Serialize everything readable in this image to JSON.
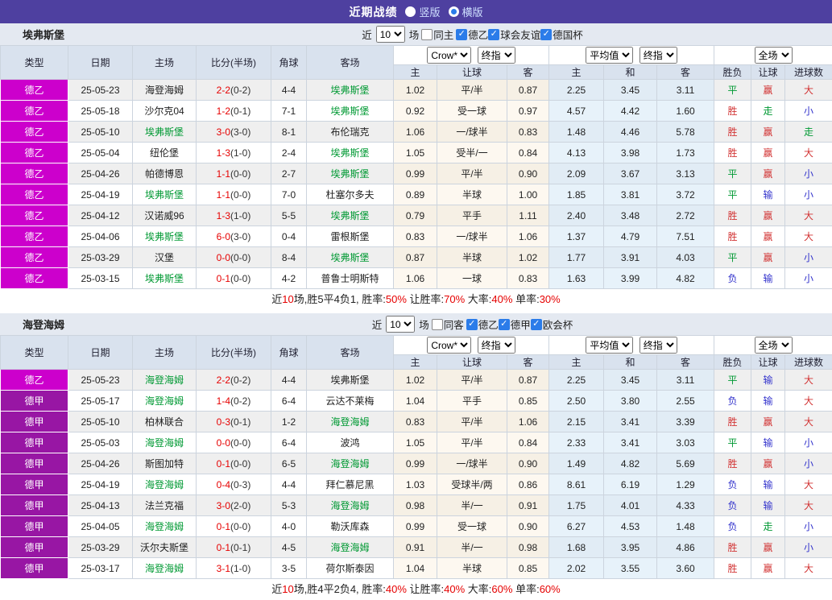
{
  "header": {
    "title": "近期战绩",
    "vertical": {
      "label": "竖版",
      "checked": false
    },
    "horizontal": {
      "label": "横版",
      "checked": true
    }
  },
  "colors": {
    "topbar": "#4e40a0",
    "league_de2": "#cc00cc",
    "league_de1": "#9816a4",
    "win_red": "#d23333",
    "draw_green": "#009933",
    "lose_blue": "#3333cc",
    "score_red": "#e60000",
    "checkbox_blue": "#2b7ce9"
  },
  "sections": [
    {
      "team": "埃弗斯堡",
      "filter": {
        "near_label": "近",
        "count": "10",
        "games_label": "场",
        "same_label": "同主",
        "same_checked": false,
        "leagues": [
          {
            "label": "德乙",
            "checked": true
          },
          {
            "label": "球会友谊",
            "checked": true
          },
          {
            "label": "德国杯",
            "checked": true
          }
        ]
      },
      "columns": {
        "type": "类型",
        "date": "日期",
        "home": "主场",
        "score": "比分(半场)",
        "corner": "角球",
        "away": "客场",
        "h": "主",
        "hcap": "让球",
        "a": "客",
        "avg_h": "主",
        "avg_d": "和",
        "avg_a": "客",
        "wdl": "胜负",
        "hres": "让球",
        "goals": "进球数"
      },
      "selects": {
        "book": "Crow*",
        "final1": "终指",
        "avg": "平均值",
        "final2": "终指",
        "scope": "全场"
      },
      "rows": [
        {
          "league": "德乙",
          "lgc": "de2",
          "date": "25-05-23",
          "home": "海登海姆",
          "home_c": "k",
          "score": "2-2",
          "half": "(0-2)",
          "corner": "4-4",
          "away": "埃弗斯堡",
          "away_c": "g",
          "o1": "1.02",
          "hcap": "平/半",
          "o2": "0.87",
          "a1": "2.25",
          "a2": "3.45",
          "a3": "3.11",
          "wdl": "平",
          "wdl_c": "g",
          "hres": "赢",
          "hres_c": "r",
          "ou": "大",
          "ou_c": "r"
        },
        {
          "league": "德乙",
          "lgc": "de2",
          "date": "25-05-18",
          "home": "沙尔克04",
          "home_c": "k",
          "score": "1-2",
          "half": "(0-1)",
          "corner": "7-1",
          "away": "埃弗斯堡",
          "away_c": "g",
          "o1": "0.92",
          "hcap": "受一球",
          "o2": "0.97",
          "a1": "4.57",
          "a2": "4.42",
          "a3": "1.60",
          "wdl": "胜",
          "wdl_c": "r",
          "hres": "走",
          "hres_c": "g",
          "ou": "小",
          "ou_c": "b"
        },
        {
          "league": "德乙",
          "lgc": "de2",
          "date": "25-05-10",
          "home": "埃弗斯堡",
          "home_c": "g",
          "score": "3-0",
          "half": "(3-0)",
          "corner": "8-1",
          "away": "布伦瑞克",
          "away_c": "k",
          "o1": "1.06",
          "hcap": "一/球半",
          "o2": "0.83",
          "a1": "1.48",
          "a2": "4.46",
          "a3": "5.78",
          "wdl": "胜",
          "wdl_c": "r",
          "hres": "赢",
          "hres_c": "r",
          "ou": "走",
          "ou_c": "g"
        },
        {
          "league": "德乙",
          "lgc": "de2",
          "date": "25-05-04",
          "home": "纽伦堡",
          "home_c": "k",
          "score": "1-3",
          "half": "(1-0)",
          "corner": "2-4",
          "away": "埃弗斯堡",
          "away_c": "g",
          "o1": "1.05",
          "hcap": "受半/一",
          "o2": "0.84",
          "a1": "4.13",
          "a2": "3.98",
          "a3": "1.73",
          "wdl": "胜",
          "wdl_c": "r",
          "hres": "赢",
          "hres_c": "r",
          "ou": "大",
          "ou_c": "r"
        },
        {
          "league": "德乙",
          "lgc": "de2",
          "date": "25-04-26",
          "home": "帕德博恩",
          "home_c": "k",
          "score": "1-1",
          "half": "(0-0)",
          "corner": "2-7",
          "away": "埃弗斯堡",
          "away_c": "g",
          "o1": "0.99",
          "hcap": "平/半",
          "o2": "0.90",
          "a1": "2.09",
          "a2": "3.67",
          "a3": "3.13",
          "wdl": "平",
          "wdl_c": "g",
          "hres": "赢",
          "hres_c": "r",
          "ou": "小",
          "ou_c": "b"
        },
        {
          "league": "德乙",
          "lgc": "de2",
          "date": "25-04-19",
          "home": "埃弗斯堡",
          "home_c": "g",
          "score": "1-1",
          "half": "(0-0)",
          "corner": "7-0",
          "away": "杜塞尔多夫",
          "away_c": "k",
          "o1": "0.89",
          "hcap": "半球",
          "o2": "1.00",
          "a1": "1.85",
          "a2": "3.81",
          "a3": "3.72",
          "wdl": "平",
          "wdl_c": "g",
          "hres": "输",
          "hres_c": "b",
          "ou": "小",
          "ou_c": "b"
        },
        {
          "league": "德乙",
          "lgc": "de2",
          "date": "25-04-12",
          "home": "汉诺威96",
          "home_c": "k",
          "score": "1-3",
          "half": "(1-0)",
          "corner": "5-5",
          "away": "埃弗斯堡",
          "away_c": "g",
          "o1": "0.79",
          "hcap": "平手",
          "o2": "1.11",
          "a1": "2.40",
          "a2": "3.48",
          "a3": "2.72",
          "wdl": "胜",
          "wdl_c": "r",
          "hres": "赢",
          "hres_c": "r",
          "ou": "大",
          "ou_c": "r"
        },
        {
          "league": "德乙",
          "lgc": "de2",
          "date": "25-04-06",
          "home": "埃弗斯堡",
          "home_c": "g",
          "score": "6-0",
          "half": "(3-0)",
          "corner": "0-4",
          "away": "雷根斯堡",
          "away_c": "k",
          "o1": "0.83",
          "hcap": "一/球半",
          "o2": "1.06",
          "a1": "1.37",
          "a2": "4.79",
          "a3": "7.51",
          "wdl": "胜",
          "wdl_c": "r",
          "hres": "赢",
          "hres_c": "r",
          "ou": "大",
          "ou_c": "r"
        },
        {
          "league": "德乙",
          "lgc": "de2",
          "date": "25-03-29",
          "home": "汉堡",
          "home_c": "k",
          "score": "0-0",
          "half": "(0-0)",
          "corner": "8-4",
          "away": "埃弗斯堡",
          "away_c": "g",
          "o1": "0.87",
          "hcap": "半球",
          "o2": "1.02",
          "a1": "1.77",
          "a2": "3.91",
          "a3": "4.03",
          "wdl": "平",
          "wdl_c": "g",
          "hres": "赢",
          "hres_c": "r",
          "ou": "小",
          "ou_c": "b"
        },
        {
          "league": "德乙",
          "lgc": "de2",
          "date": "25-03-15",
          "home": "埃弗斯堡",
          "home_c": "g",
          "score": "0-1",
          "half": "(0-0)",
          "corner": "4-2",
          "away": "普鲁士明斯特",
          "away_c": "k",
          "o1": "1.06",
          "hcap": "一球",
          "o2": "0.83",
          "a1": "1.63",
          "a2": "3.99",
          "a3": "4.82",
          "wdl": "负",
          "wdl_c": "b",
          "hres": "输",
          "hres_c": "b",
          "ou": "小",
          "ou_c": "b"
        }
      ],
      "summary": [
        {
          "t": "近",
          "c": "k"
        },
        {
          "t": "10",
          "c": "r"
        },
        {
          "t": "场,胜5平4负1, 胜率:",
          "c": "k"
        },
        {
          "t": "50%",
          "c": "r"
        },
        {
          "t": " 让胜率:",
          "c": "k"
        },
        {
          "t": "70%",
          "c": "r"
        },
        {
          "t": " 大率:",
          "c": "k"
        },
        {
          "t": "40%",
          "c": "r"
        },
        {
          "t": " 单率:",
          "c": "k"
        },
        {
          "t": "30%",
          "c": "r"
        }
      ]
    },
    {
      "team": "海登海姆",
      "filter": {
        "near_label": "近",
        "count": "10",
        "games_label": "场",
        "same_label": "同客",
        "same_checked": false,
        "leagues": [
          {
            "label": "德乙",
            "checked": true
          },
          {
            "label": "德甲",
            "checked": true
          },
          {
            "label": "欧会杯",
            "checked": true
          }
        ]
      },
      "columns": {
        "type": "类型",
        "date": "日期",
        "home": "主场",
        "score": "比分(半场)",
        "corner": "角球",
        "away": "客场",
        "h": "主",
        "hcap": "让球",
        "a": "客",
        "avg_h": "主",
        "avg_d": "和",
        "avg_a": "客",
        "wdl": "胜负",
        "hres": "让球",
        "goals": "进球数"
      },
      "selects": {
        "book": "Crow*",
        "final1": "终指",
        "avg": "平均值",
        "final2": "终指",
        "scope": "全场"
      },
      "rows": [
        {
          "league": "德乙",
          "lgc": "de2",
          "date": "25-05-23",
          "home": "海登海姆",
          "home_c": "g",
          "score": "2-2",
          "half": "(0-2)",
          "corner": "4-4",
          "away": "埃弗斯堡",
          "away_c": "k",
          "o1": "1.02",
          "hcap": "平/半",
          "o2": "0.87",
          "a1": "2.25",
          "a2": "3.45",
          "a3": "3.11",
          "wdl": "平",
          "wdl_c": "g",
          "hres": "输",
          "hres_c": "b",
          "ou": "大",
          "ou_c": "r"
        },
        {
          "league": "德甲",
          "lgc": "de1",
          "date": "25-05-17",
          "home": "海登海姆",
          "home_c": "g",
          "score": "1-4",
          "half": "(0-2)",
          "corner": "6-4",
          "away": "云达不莱梅",
          "away_c": "k",
          "o1": "1.04",
          "hcap": "平手",
          "o2": "0.85",
          "a1": "2.50",
          "a2": "3.80",
          "a3": "2.55",
          "wdl": "负",
          "wdl_c": "b",
          "hres": "输",
          "hres_c": "b",
          "ou": "大",
          "ou_c": "r"
        },
        {
          "league": "德甲",
          "lgc": "de1",
          "date": "25-05-10",
          "home": "柏林联合",
          "home_c": "k",
          "score": "0-3",
          "half": "(0-1)",
          "corner": "1-2",
          "away": "海登海姆",
          "away_c": "g",
          "o1": "0.83",
          "hcap": "平/半",
          "o2": "1.06",
          "a1": "2.15",
          "a2": "3.41",
          "a3": "3.39",
          "wdl": "胜",
          "wdl_c": "r",
          "hres": "赢",
          "hres_c": "r",
          "ou": "大",
          "ou_c": "r"
        },
        {
          "league": "德甲",
          "lgc": "de1",
          "date": "25-05-03",
          "home": "海登海姆",
          "home_c": "g",
          "score": "0-0",
          "half": "(0-0)",
          "corner": "6-4",
          "away": "波鸿",
          "away_c": "k",
          "o1": "1.05",
          "hcap": "平/半",
          "o2": "0.84",
          "a1": "2.33",
          "a2": "3.41",
          "a3": "3.03",
          "wdl": "平",
          "wdl_c": "g",
          "hres": "输",
          "hres_c": "b",
          "ou": "小",
          "ou_c": "b"
        },
        {
          "league": "德甲",
          "lgc": "de1",
          "date": "25-04-26",
          "home": "斯图加特",
          "home_c": "k",
          "score": "0-1",
          "half": "(0-0)",
          "corner": "6-5",
          "away": "海登海姆",
          "away_c": "g",
          "o1": "0.99",
          "hcap": "一/球半",
          "o2": "0.90",
          "a1": "1.49",
          "a2": "4.82",
          "a3": "5.69",
          "wdl": "胜",
          "wdl_c": "r",
          "hres": "赢",
          "hres_c": "r",
          "ou": "小",
          "ou_c": "b"
        },
        {
          "league": "德甲",
          "lgc": "de1",
          "date": "25-04-19",
          "home": "海登海姆",
          "home_c": "g",
          "score": "0-4",
          "half": "(0-3)",
          "corner": "4-4",
          "away": "拜仁慕尼黑",
          "away_c": "k",
          "o1": "1.03",
          "hcap": "受球半/两",
          "o2": "0.86",
          "a1": "8.61",
          "a2": "6.19",
          "a3": "1.29",
          "wdl": "负",
          "wdl_c": "b",
          "hres": "输",
          "hres_c": "b",
          "ou": "大",
          "ou_c": "r"
        },
        {
          "league": "德甲",
          "lgc": "de1",
          "date": "25-04-13",
          "home": "法兰克福",
          "home_c": "k",
          "score": "3-0",
          "half": "(2-0)",
          "corner": "5-3",
          "away": "海登海姆",
          "away_c": "g",
          "o1": "0.98",
          "hcap": "半/一",
          "o2": "0.91",
          "a1": "1.75",
          "a2": "4.01",
          "a3": "4.33",
          "wdl": "负",
          "wdl_c": "b",
          "hres": "输",
          "hres_c": "b",
          "ou": "大",
          "ou_c": "r"
        },
        {
          "league": "德甲",
          "lgc": "de1",
          "date": "25-04-05",
          "home": "海登海姆",
          "home_c": "g",
          "score": "0-1",
          "half": "(0-0)",
          "corner": "4-0",
          "away": "勒沃库森",
          "away_c": "k",
          "o1": "0.99",
          "hcap": "受一球",
          "o2": "0.90",
          "a1": "6.27",
          "a2": "4.53",
          "a3": "1.48",
          "wdl": "负",
          "wdl_c": "b",
          "hres": "走",
          "hres_c": "g",
          "ou": "小",
          "ou_c": "b"
        },
        {
          "league": "德甲",
          "lgc": "de1",
          "date": "25-03-29",
          "home": "沃尔夫斯堡",
          "home_c": "k",
          "score": "0-1",
          "half": "(0-1)",
          "corner": "4-5",
          "away": "海登海姆",
          "away_c": "g",
          "o1": "0.91",
          "hcap": "半/一",
          "o2": "0.98",
          "a1": "1.68",
          "a2": "3.95",
          "a3": "4.86",
          "wdl": "胜",
          "wdl_c": "r",
          "hres": "赢",
          "hres_c": "r",
          "ou": "小",
          "ou_c": "b"
        },
        {
          "league": "德甲",
          "lgc": "de1",
          "date": "25-03-17",
          "home": "海登海姆",
          "home_c": "g",
          "score": "3-1",
          "half": "(1-0)",
          "corner": "3-5",
          "away": "荷尔斯泰因",
          "away_c": "k",
          "o1": "1.04",
          "hcap": "半球",
          "o2": "0.85",
          "a1": "2.02",
          "a2": "3.55",
          "a3": "3.60",
          "wdl": "胜",
          "wdl_c": "r",
          "hres": "赢",
          "hres_c": "r",
          "ou": "大",
          "ou_c": "r"
        }
      ],
      "summary": [
        {
          "t": "近",
          "c": "k"
        },
        {
          "t": "10",
          "c": "r"
        },
        {
          "t": "场,胜4平2负4, 胜率:",
          "c": "k"
        },
        {
          "t": "40%",
          "c": "r"
        },
        {
          "t": " 让胜率:",
          "c": "k"
        },
        {
          "t": "40%",
          "c": "r"
        },
        {
          "t": " 大率:",
          "c": "k"
        },
        {
          "t": "60%",
          "c": "r"
        },
        {
          "t": " 单率:",
          "c": "k"
        },
        {
          "t": "60%",
          "c": "r"
        }
      ]
    }
  ]
}
